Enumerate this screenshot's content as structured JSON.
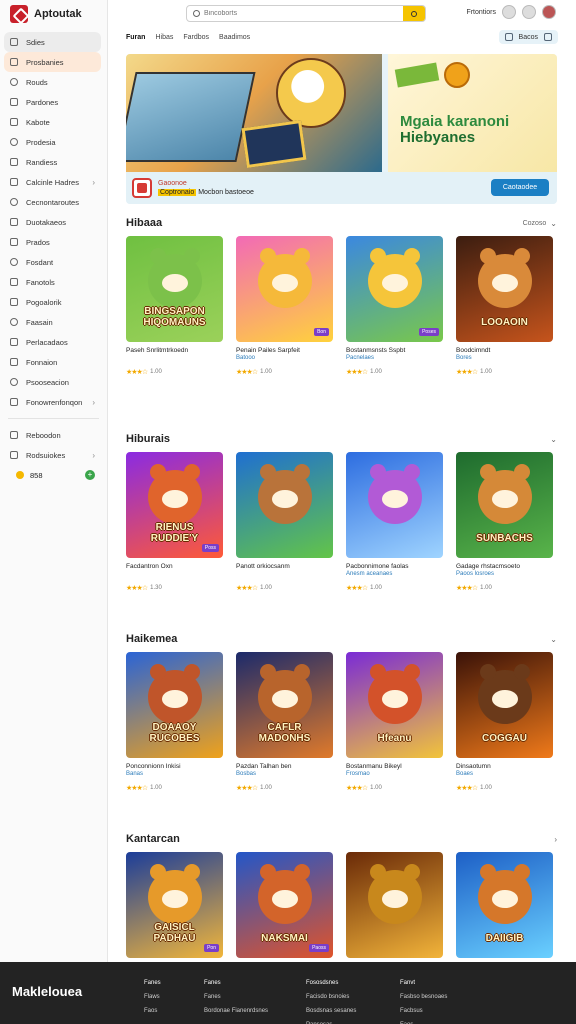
{
  "app": {
    "name": "Aptoutak"
  },
  "search": {
    "placeholder": "Bincoborts",
    "value": ""
  },
  "topbar": {
    "account_label": "Frtontiors"
  },
  "sidebar": {
    "items": [
      {
        "label": "Sdies",
        "icon": "home-icon"
      },
      {
        "label": "Prosbanies",
        "icon": "flame-icon"
      },
      {
        "label": "Rouds",
        "icon": "compass-icon"
      },
      {
        "label": "Pardones",
        "icon": "gamepad-icon"
      },
      {
        "label": "Kabote",
        "icon": "controller-icon"
      },
      {
        "label": "Prodesia",
        "icon": "tag-icon"
      },
      {
        "label": "Randiess",
        "icon": "grid-icon"
      },
      {
        "label": "Calcinle Hadres",
        "icon": "folder-icon"
      },
      {
        "label": "Cecnontaroutes",
        "icon": "globe-icon"
      },
      {
        "label": "Duotakaeos",
        "icon": "chart-icon"
      },
      {
        "label": "Prados",
        "icon": "star-icon"
      },
      {
        "label": "Fosdant",
        "icon": "trophy-icon"
      },
      {
        "label": "Fanotols",
        "icon": "puzzle-icon"
      },
      {
        "label": "Pogoalorik",
        "icon": "book-icon"
      },
      {
        "label": "Faasain",
        "icon": "camera-icon"
      },
      {
        "label": "Perlacadaos",
        "icon": "users-icon"
      },
      {
        "label": "Fonnaion",
        "icon": "music-icon"
      },
      {
        "label": "Psooseacion",
        "icon": "heart-icon"
      },
      {
        "label": "Fonowrenfonqon",
        "icon": "link-icon"
      }
    ],
    "extra": [
      {
        "label": "Reboodon",
        "icon": "library-icon"
      },
      {
        "label": "Rodsuiokes",
        "icon": "settings-icon"
      }
    ],
    "coins": {
      "value": "858"
    }
  },
  "tabs": [
    "Furan",
    "Hibas",
    "Fardbos",
    "Baadimos"
  ],
  "tab_actions": {
    "label": "Bacos"
  },
  "hero": {
    "title_line1": "Mgaia karanoni",
    "title_line2": "Hiebyanes",
    "bar_line1": "Gaoonoe",
    "bar_line2": "Coptronaio",
    "bar_line3": "Mocbon bastoeoe",
    "cta": "Caotaodee"
  },
  "sections": [
    {
      "title": "Hibaaa",
      "more": "Cozoso",
      "cards": [
        {
          "caption": "BINGSAPON HIQOMAUNS",
          "name": "Paseh Snrlitmtrkoedn",
          "sub": "",
          "rating": "1.00",
          "colors": [
            "#6fc041",
            "#9bd15a"
          ],
          "blob": "#7cc14a",
          "badge": ""
        },
        {
          "caption": "",
          "name": "Penain Pailes Sarpfeit",
          "sub": "Batooo",
          "rating": "1.00",
          "colors": [
            "#f26ab6",
            "#ffd23c"
          ],
          "blob": "#f5b93a",
          "badge": "Bon"
        },
        {
          "caption": "",
          "name": "Bostanmsnsts Sspbt",
          "sub": "Pacnelaes",
          "rating": "1.00",
          "colors": [
            "#3b88e0",
            "#79c84a"
          ],
          "blob": "#f5c53a",
          "badge": "Poses"
        },
        {
          "caption": "LOOAOIN",
          "name": "Boodcimndt",
          "sub": "Bores",
          "rating": "1.00",
          "colors": [
            "#3b1d10",
            "#c6541c"
          ],
          "blob": "#d98a3a",
          "badge": ""
        }
      ]
    },
    {
      "title": "Hiburais",
      "more": "",
      "cards": [
        {
          "caption": "RIENUS RUDDIE'Y",
          "name": "Facdantron Oxn",
          "sub": "",
          "rating": "1.30",
          "colors": [
            "#8a2be2",
            "#ff5a36"
          ],
          "blob": "#e0642c",
          "badge": "Poss"
        },
        {
          "caption": "",
          "name": "Panott orkiocsanm",
          "sub": "",
          "rating": "1.00",
          "colors": [
            "#1f6fd1",
            "#63c548"
          ],
          "blob": "#b9733a",
          "badge": ""
        },
        {
          "caption": "",
          "name": "Pacbonnimone faolas",
          "sub": "Anesm aceanaes",
          "rating": "1.00",
          "colors": [
            "#2d6de0",
            "#9fd4ff"
          ],
          "blob": "#b25ad6",
          "badge": ""
        },
        {
          "caption": "SUNBACHS",
          "name": "Gadage rhstacmsoeto",
          "sub": "Paoos losroes",
          "rating": "1.00",
          "colors": [
            "#1e6b2e",
            "#59b44a"
          ],
          "blob": "#d58938",
          "badge": ""
        }
      ]
    },
    {
      "title": "Haikemea",
      "more": "",
      "cards": [
        {
          "caption": "DOAAOY RUCOBES",
          "name": "Ponconnionn Inkisi",
          "sub": "Banas",
          "rating": "1.00",
          "colors": [
            "#2a64d6",
            "#f0a21a"
          ],
          "blob": "#c0552a",
          "badge": ""
        },
        {
          "caption": "CAFLR MADONHS",
          "name": "Pazdan Talhan ben",
          "sub": "Bosbas",
          "rating": "1.00",
          "colors": [
            "#1b2a6b",
            "#e07a2a"
          ],
          "blob": "#b8642c",
          "badge": ""
        },
        {
          "caption": "Hfeanu",
          "name": "Bostanmanu Bikeyl",
          "sub": "Frosmao",
          "rating": "1.00",
          "colors": [
            "#7a2bd6",
            "#f2c43a"
          ],
          "blob": "#d3522a",
          "badge": ""
        },
        {
          "caption": "COGGAU",
          "name": "Dinsaotumn",
          "sub": "Boaes",
          "rating": "1.00",
          "colors": [
            "#3a1208",
            "#f07a1a"
          ],
          "blob": "#6b3a1a",
          "badge": ""
        }
      ]
    },
    {
      "title": "Kantarcan",
      "more": "",
      "cards": [
        {
          "caption": "GAISICL PADHAU",
          "name": "",
          "sub": "",
          "rating": "",
          "colors": [
            "#1b3d9a",
            "#f2b63a"
          ],
          "blob": "#e69a2a",
          "badge": "Pon"
        },
        {
          "caption": "NAKSMAI",
          "name": "",
          "sub": "",
          "rating": "",
          "colors": [
            "#2356c8",
            "#e0542a"
          ],
          "blob": "#d3642a",
          "badge": "Paoss"
        },
        {
          "caption": "",
          "name": "",
          "sub": "",
          "rating": "",
          "colors": [
            "#6a2a08",
            "#f2b43a"
          ],
          "blob": "#c8881c",
          "badge": ""
        },
        {
          "caption": "DAIIGIB",
          "name": "",
          "sub": "",
          "rating": "",
          "colors": [
            "#1d5fc6",
            "#6ad0ff"
          ],
          "blob": "#d5772a",
          "badge": ""
        }
      ]
    }
  ],
  "footer": {
    "brand": "Maklelouea",
    "cols": [
      {
        "h": "Fanes",
        "items": [
          "Flaws",
          "Faos"
        ]
      },
      {
        "h": "Fanes",
        "items": [
          "Fanes",
          "Bordonae Fianenrdsnes"
        ]
      },
      {
        "h": "Fososdsnes",
        "items": [
          "Facisdo bsnoies",
          "Bosdsnas sesanes",
          "Pansosas"
        ]
      },
      {
        "h": "Fanvt",
        "items": [
          "Fasbso besnoaes",
          "Facbsus",
          "Faos"
        ]
      }
    ]
  }
}
